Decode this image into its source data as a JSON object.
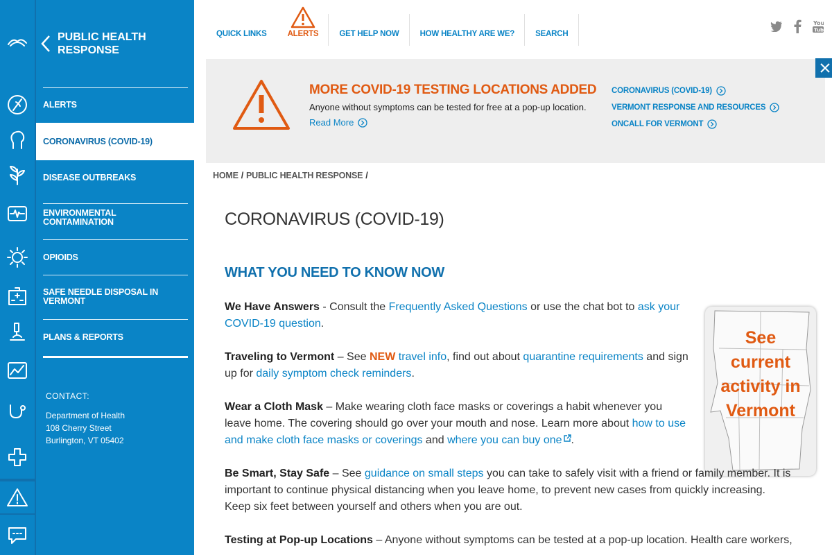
{
  "section_nav": {
    "title": "PUBLIC HEALTH RESPONSE",
    "items": [
      {
        "label": "ALERTS"
      },
      {
        "label": "CORONAVIRUS (COVID-19)"
      },
      {
        "label": "DISEASE OUTBREAKS"
      },
      {
        "label": "ENVIRONMENTAL CONTAMINATION"
      },
      {
        "label": "OPIOIDS"
      },
      {
        "label": "SAFE NEEDLE DISPOSAL IN VERMONT"
      },
      {
        "label": "PLANS & REPORTS"
      }
    ],
    "contact_label": "CONTACT:",
    "contact_name": "Department of Health",
    "contact_street": "108 Cherry Street",
    "contact_city": "Burlington, VT 05402"
  },
  "top_nav": {
    "quick_links": "QUICK LINKS",
    "alerts": "ALERTS",
    "get_help": "GET HELP NOW",
    "how_healthy": "HOW HEALTHY ARE WE?",
    "search": "SEARCH"
  },
  "banner": {
    "headline": "MORE COVID-19 TESTING LOCATIONS ADDED",
    "description": "Anyone without symptoms can be tested for free at a pop-up location.",
    "read_more": "Read More",
    "links": [
      "CORONAVIRUS (COVID-19)",
      "VERMONT RESPONSE AND RESOURCES",
      "ONCALL FOR VERMONT"
    ]
  },
  "breadcrumb": {
    "home": "HOME",
    "current": "PUBLIC HEALTH RESPONSE"
  },
  "page_title": "CORONAVIRUS (COVID-19)",
  "section_heading": "WHAT YOU NEED TO KNOW NOW",
  "map_card": {
    "line1": "See",
    "line2": "current",
    "line3": "activity in",
    "line4": "Vermont"
  },
  "paragraphs": {
    "p1": {
      "bold": "We Have Answers",
      "t1": " - Consult the ",
      "l1": "Frequently Asked Questions",
      "t2": " or use the chat bot to ",
      "l2": "ask your COVID-19 question",
      "t3": "."
    },
    "p2": {
      "bold": "Traveling to Vermont",
      "t1": " – See ",
      "new": "NEW",
      "l1": " travel info",
      "t2": ", find out about ",
      "l2": "quarantine requirements",
      "t3": " and sign up for ",
      "l3": "daily symptom check reminders",
      "t4": "."
    },
    "p3": {
      "bold": "Wear a Cloth Mask",
      "t1": " – Make wearing cloth face masks or coverings a habit whenever you leave home. The covering should go over your mouth and nose. Learn more about ",
      "l1": "how to use and make cloth face masks or coverings",
      "t2": " and ",
      "l2": "where you can buy one",
      "t3": "."
    },
    "p4": {
      "bold": "Be Smart, Stay Safe",
      "t1": " – See ",
      "l1": "guidance on small steps",
      "t2": " you can take to safely visit with a friend or family member. It is important to continue physical distancing when you leave home, to prevent new cases from quickly increasing. Keep six feet between yourself and others when you are out."
    },
    "p5": {
      "bold": "Testing at Pop-up Locations",
      "t1": " – Anyone without symptoms can be tested at a pop-up location. Health care workers,"
    }
  },
  "colors": {
    "primary": "#0a84c6",
    "dark_primary": "#1070ad",
    "accent": "#e05a12",
    "banner_bg": "#eeeeee"
  }
}
